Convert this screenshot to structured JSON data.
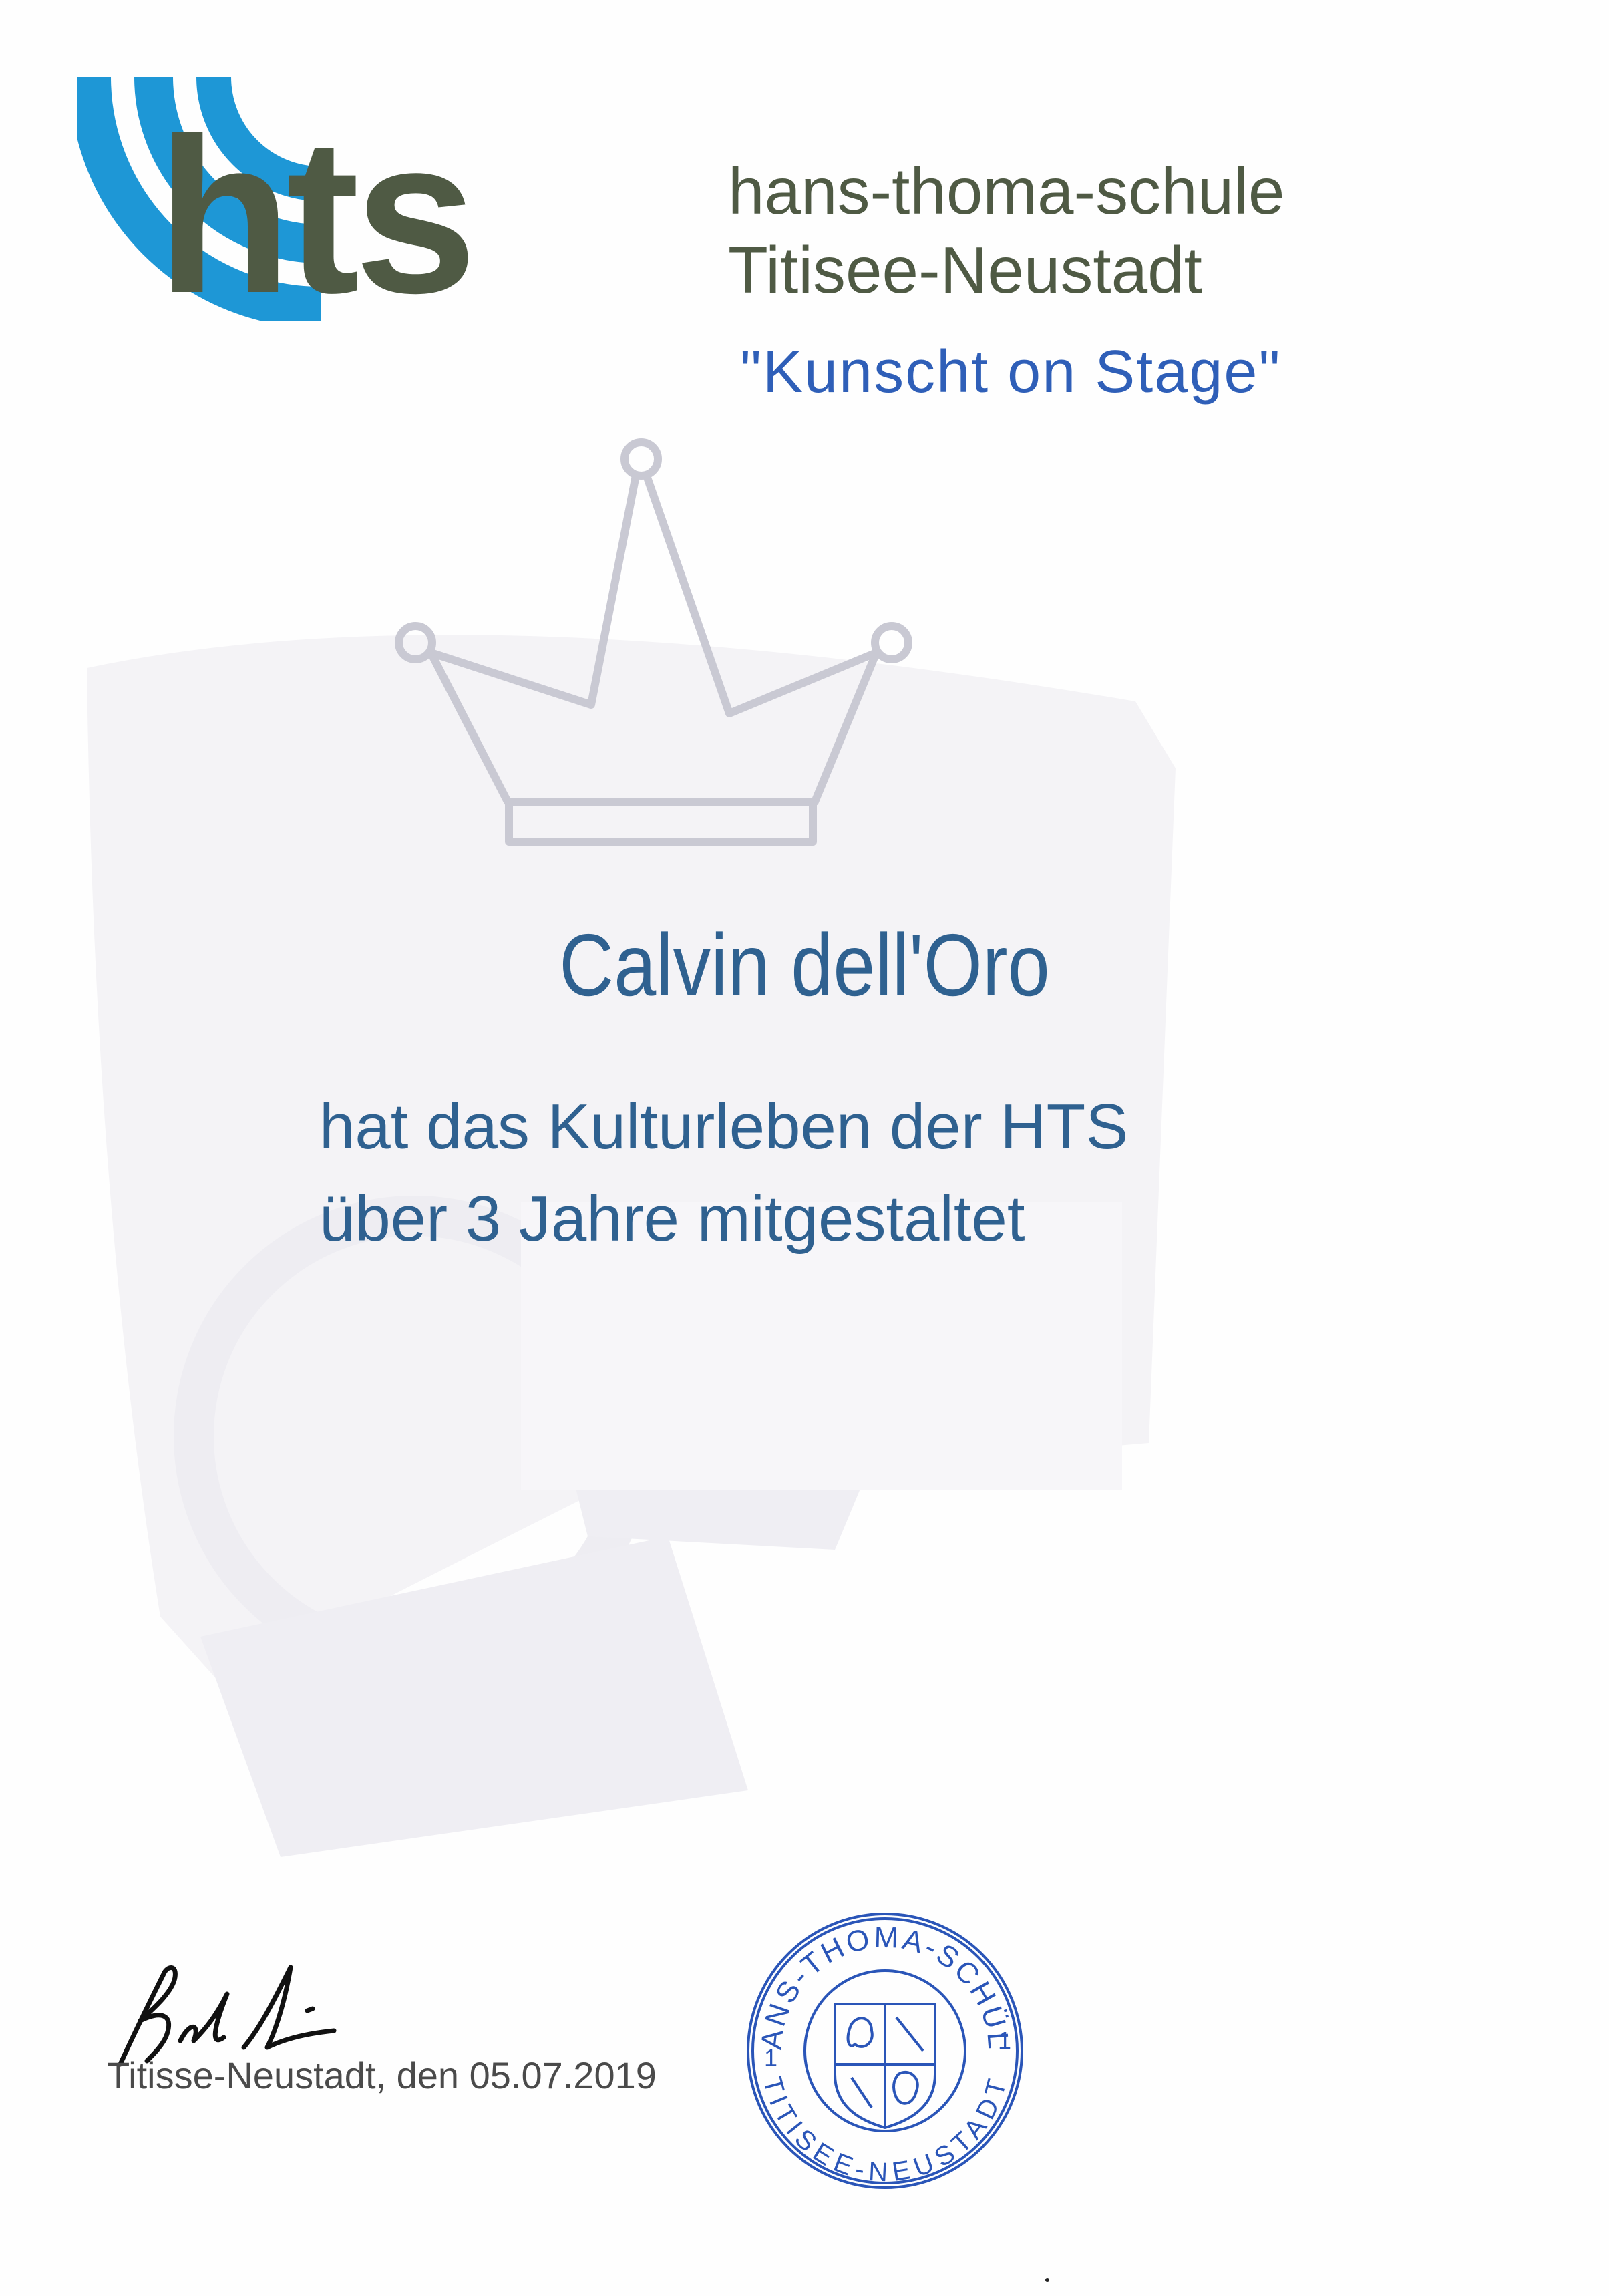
{
  "header": {
    "logo": {
      "icon": "hts-logo-arcs",
      "text": "hts",
      "arc_color": "#1e97d6",
      "text_color": "#4f5a44"
    },
    "school_name": "hans-thoma-schule",
    "school_city": "Titisee-Neustadt",
    "event_title": "\"Kunscht on Stage\""
  },
  "crown": {
    "icon": "crown-outline-icon",
    "color": "#c9c9d3"
  },
  "certificate": {
    "recipient": "Calvin dell'Oro",
    "statement_line1": "hat das Kulturleben der HTS",
    "statement_line2": "über 3 Jahre mitgestaltet",
    "text_color": "#2f6190"
  },
  "footer": {
    "place_date": "Titisse-Neustadt, den 05.07.2019",
    "signature": "handwritten-signature",
    "stamp": {
      "top_text": "HANS-THOMA-SCHÜLE",
      "bottom_text": "TITISEE-NEUSTADT",
      "left_mark": "1",
      "right_mark": "1",
      "color": "#2a55b8",
      "icon": "coat-of-arms-icon"
    }
  }
}
